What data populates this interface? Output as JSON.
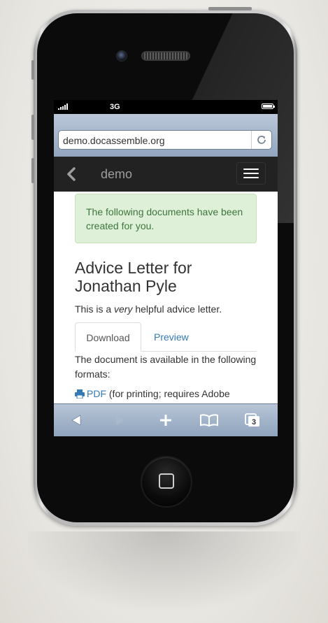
{
  "status_bar": {
    "network": "3G"
  },
  "browser": {
    "url": "demo.docassemble.org"
  },
  "navbar": {
    "brand": "demo"
  },
  "alert": {
    "text": "The following documents have been created for you."
  },
  "document": {
    "title": "Advice Letter for Jonathan Pyle",
    "subtitle_before": "This is a ",
    "subtitle_emphasis": "very",
    "subtitle_after": " helpful advice letter."
  },
  "tabs": {
    "download": "Download",
    "preview": "Preview"
  },
  "availability": {
    "text": "The document is available in the following formats:"
  },
  "formats": {
    "pdf_label": "PDF",
    "pdf_note": " (for printing; requires Adobe"
  },
  "toolbar": {
    "tabs_count": "3"
  },
  "colors": {
    "link": "#337ab7",
    "alert_bg": "#dff0d8",
    "alert_text": "#3c763d",
    "navbar_bg": "#222222"
  }
}
